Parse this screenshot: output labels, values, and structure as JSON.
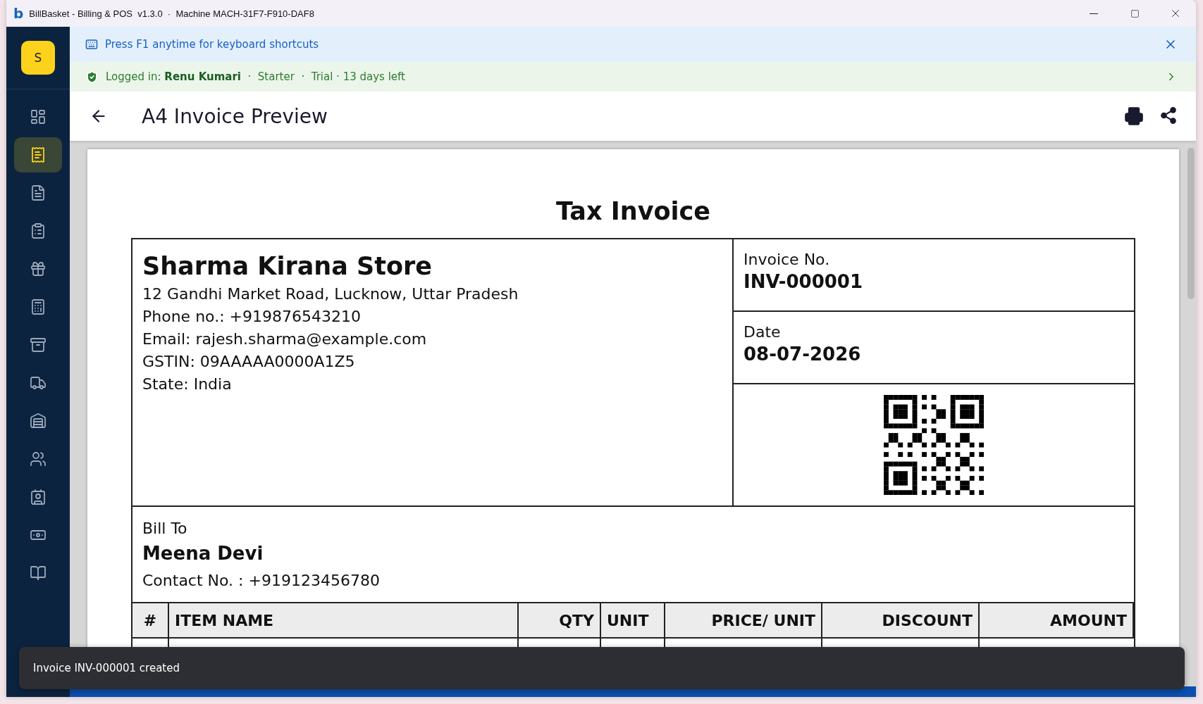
{
  "window": {
    "logo": "b",
    "title": "BillBasket - Billing & POS  v1.3.0  ·  Machine MACH-31F7-F910-DAF8"
  },
  "sidebar": {
    "avatar": "S",
    "items": [
      {
        "kind": "dashboard",
        "selected": false
      },
      {
        "kind": "receipt",
        "selected": true
      },
      {
        "kind": "document",
        "selected": false
      },
      {
        "kind": "clipboard",
        "selected": false
      },
      {
        "kind": "gift",
        "selected": false
      },
      {
        "kind": "register",
        "selected": false
      },
      {
        "kind": "archive",
        "selected": false
      },
      {
        "kind": "truck",
        "selected": false
      },
      {
        "kind": "warehouse",
        "selected": false
      },
      {
        "kind": "users",
        "selected": false
      },
      {
        "kind": "contact",
        "selected": false
      },
      {
        "kind": "cash",
        "selected": false
      },
      {
        "kind": "book",
        "selected": false
      }
    ]
  },
  "shortcut_banner": {
    "text": "Press F1 anytime for keyboard shortcuts"
  },
  "account_banner": {
    "text": "Logged in: **Renu Kumari**  ·  Starter  ·  Trial · 13 days left"
  },
  "header": {
    "title": "A4 Invoice Preview"
  },
  "invoice": {
    "title": "Tax Invoice",
    "seller": {
      "name": "Sharma Kirana Store",
      "lines": [
        "12 Gandhi Market Road, Lucknow, Uttar Pradesh",
        "Phone no.: +919876543210",
        "Email: rajesh.sharma@example.com",
        "GSTIN: 09AAAAA0000A1Z5",
        "State: India"
      ]
    },
    "meta": [
      {
        "label": "Invoice No.",
        "value": "INV-000001"
      },
      {
        "label": "Date",
        "value": "08-07-2026"
      }
    ],
    "bill_to": {
      "label": "Bill To",
      "name": "Meena Devi",
      "contact": "Contact No. : +919123456780"
    },
    "table": {
      "columns": [
        "#",
        "ITEM NAME",
        "QTY",
        "UNIT",
        "PRICE/ UNIT",
        "DISCOUNT",
        "AMOUNT"
      ]
    }
  },
  "toast": {
    "text": "Invoice INV-000001 created"
  }
}
